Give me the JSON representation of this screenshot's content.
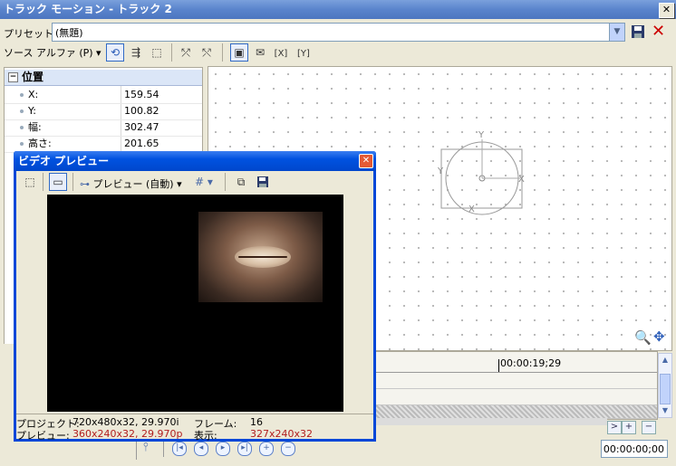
{
  "window": {
    "title": "トラック モーション - トラック 2"
  },
  "preset": {
    "label": "プリセット:",
    "value": "(無題)"
  },
  "toolbar": {
    "source_alpha": "ソース アルファ (P)"
  },
  "properties": {
    "section_title": "位置",
    "rows": [
      {
        "label": "X:",
        "value": "159.54"
      },
      {
        "label": "Y:",
        "value": "100.82"
      },
      {
        "label": "幅:",
        "value": "302.47"
      },
      {
        "label": "高さ:",
        "value": "201.65"
      }
    ]
  },
  "canvas": {
    "axis_y": "Y",
    "axis_x": "X"
  },
  "timeline": {
    "ruler_time": "00:00:19;29",
    "current_time": "00:00:00;00"
  },
  "preview_window": {
    "title": "ビデオ プレビュー",
    "mode": "プレビュー (自動)",
    "project_label": "プロジェクト:",
    "project_value": "720x480x32, 29.970i",
    "frame_label": "フレーム:",
    "frame_value": "16",
    "preview_label": "プレビュー:",
    "preview_value": "360x240x32, 29.970p",
    "display_label": "表示:",
    "display_value": "327x240x32"
  },
  "colors": {
    "title_blue": "#0047d8",
    "accent_red": "#b21e1e"
  }
}
